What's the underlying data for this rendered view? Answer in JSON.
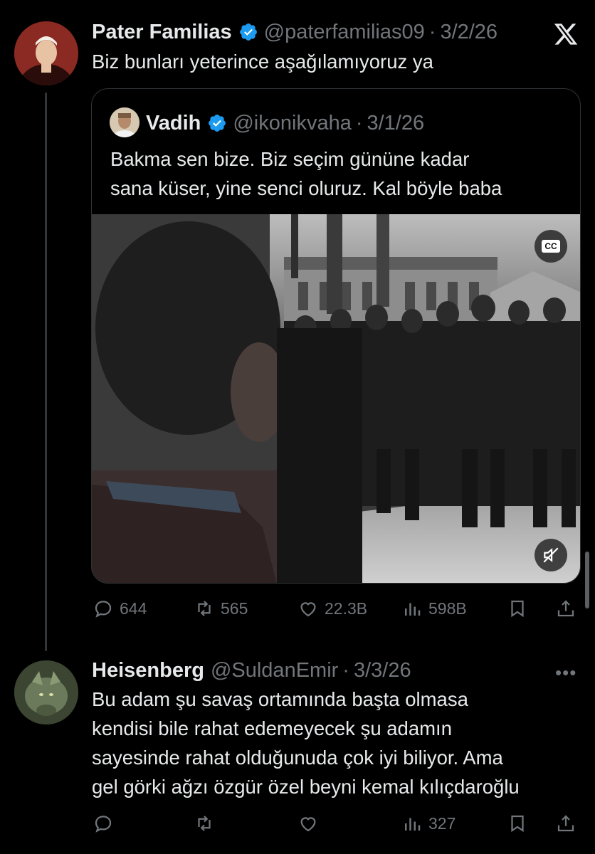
{
  "tweet": {
    "author_name": "Pater Familias",
    "author_handle": "@paterfamilias09",
    "date": "3/2/26",
    "text": "Biz bunları yeterince aşağılamıyoruz ya",
    "verified": true
  },
  "quote": {
    "author_name": "Vadih",
    "author_handle": "@ikonikvaha",
    "date": "3/1/26",
    "text_lines": [
      "Bakma sen bize. Biz seçim gününe kadar",
      "sana küser, yine senci oluruz. Kal böyle baba"
    ],
    "verified": true,
    "media": {
      "cc_label": "CC",
      "muted": true
    }
  },
  "tweet_actions": {
    "replies": "644",
    "reposts": "565",
    "likes": "22.3B",
    "views": "598B"
  },
  "reply": {
    "author_name": "Heisenberg",
    "author_handle": "@SuldanEmir",
    "date": "3/3/26",
    "text_lines": [
      "Bu adam şu savaş ortamında başta olmasa",
      "kendisi bile rahat edemeyecek şu adamın",
      "sayesinde rahat olduğunuda çok iyi biliyor. Ama",
      "gel görki ağzı özgür özel beyni kemal kılıçdaroğlu"
    ],
    "views": "327"
  },
  "colors": {
    "background": "#000000",
    "text": "#e7e9ea",
    "muted": "#71767b",
    "verified": "#1d9bf0",
    "border": "#2f3336"
  },
  "icons": [
    "x-logo-icon",
    "verified-badge-icon",
    "reply-icon",
    "repost-icon",
    "like-icon",
    "views-icon",
    "bookmark-icon",
    "share-icon",
    "more-icon",
    "cc-icon",
    "mute-icon"
  ]
}
